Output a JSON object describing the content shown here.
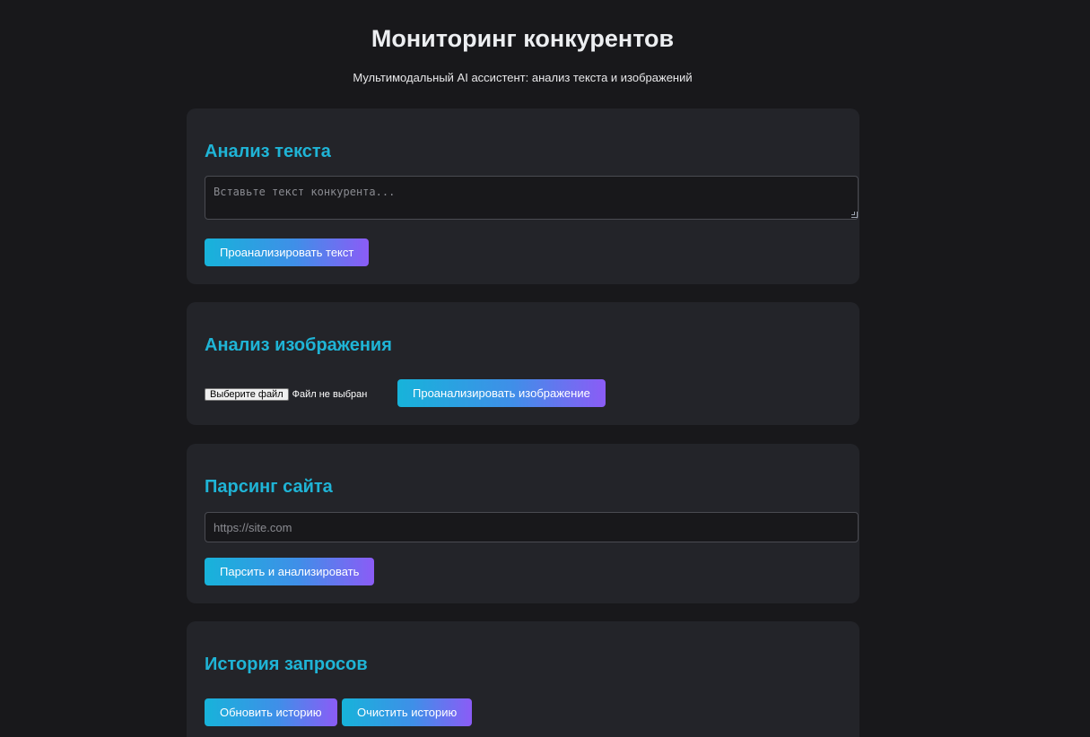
{
  "header": {
    "title": "Мониторинг конкурентов",
    "subtitle": "Мультимодальный AI ассистент: анализ текста и изображений"
  },
  "text_analysis": {
    "heading": "Анализ текста",
    "placeholder": "Вставьте текст конкурента...",
    "button_label": "Проанализировать текст"
  },
  "image_analysis": {
    "heading": "Анализ изображения",
    "file_button_label": "Выберите файл",
    "file_status": "Файл не выбран",
    "button_label": "Проанализировать изображение"
  },
  "site_parsing": {
    "heading": "Парсинг сайта",
    "placeholder": "https://site.com",
    "button_label": "Парсить и анализировать"
  },
  "history": {
    "heading": "История запросов",
    "refresh_label": "Обновить историю",
    "clear_label": "Очистить историю"
  },
  "colors": {
    "background": "#18181b",
    "card": "#232429",
    "accent": "#1fb4d6",
    "gradient_start": "#17b3da",
    "gradient_end": "#8b5cf6"
  }
}
